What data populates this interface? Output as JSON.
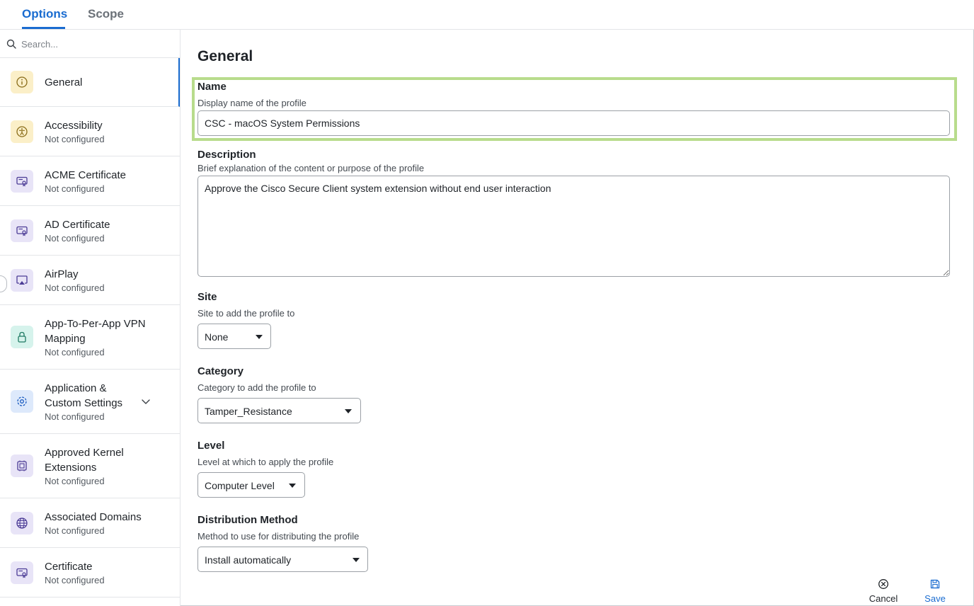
{
  "tabs": [
    {
      "label": "Options",
      "active": true
    },
    {
      "label": "Scope",
      "active": false
    }
  ],
  "sidebar": {
    "search_placeholder": "Search...",
    "items": [
      {
        "label": "General",
        "subtitle": "",
        "icon": "info-icon",
        "active": true
      },
      {
        "label": "Accessibility",
        "subtitle": "Not configured",
        "icon": "accessibility-icon"
      },
      {
        "label": "ACME Certificate",
        "subtitle": "Not configured",
        "icon": "certificate-icon"
      },
      {
        "label": "AD Certificate",
        "subtitle": "Not configured",
        "icon": "certificate-icon"
      },
      {
        "label": "AirPlay",
        "subtitle": "Not configured",
        "icon": "airplay-icon"
      },
      {
        "label": "App-To-Per-App VPN Mapping",
        "subtitle": "Not configured",
        "icon": "lock-icon"
      },
      {
        "label": "Application & Custom Settings",
        "subtitle": "Not configured",
        "icon": "gear-icon",
        "expandable": true
      },
      {
        "label": "Approved Kernel Extensions",
        "subtitle": "Not configured",
        "icon": "chip-icon"
      },
      {
        "label": "Associated Domains",
        "subtitle": "Not configured",
        "icon": "globe-icon"
      },
      {
        "label": "Certificate",
        "subtitle": "Not configured",
        "icon": "certificate-icon"
      }
    ]
  },
  "main": {
    "title": "General",
    "name": {
      "label": "Name",
      "help": "Display name of the profile",
      "value": "CSC - macOS System Permissions"
    },
    "description": {
      "label": "Description",
      "help": "Brief explanation of the content or purpose of the profile",
      "value": "Approve the Cisco Secure Client system extension without end user interaction"
    },
    "site": {
      "label": "Site",
      "help": "Site to add the profile to",
      "value": "None"
    },
    "category": {
      "label": "Category",
      "help": "Category to add the profile to",
      "value": "Tamper_Resistance"
    },
    "level": {
      "label": "Level",
      "help": "Level at which to apply the profile",
      "value": "Computer Level"
    },
    "distribution": {
      "label": "Distribution Method",
      "help": "Method to use for distributing the profile",
      "value": "Install automatically"
    }
  },
  "footer": {
    "cancel_label": "Cancel",
    "save_label": "Save"
  },
  "colors": {
    "accent": "#1a6cd0",
    "highlight": "#b8dc8c"
  }
}
